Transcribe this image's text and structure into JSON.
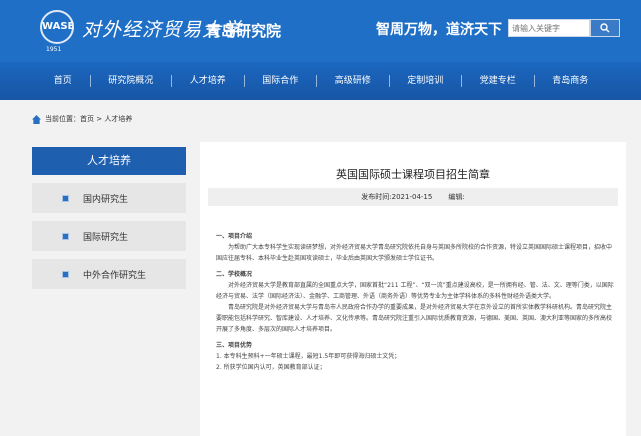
{
  "header": {
    "seal": "WASE",
    "year": "1951",
    "university": "对外经济贸易大学",
    "campus": "青岛研究院",
    "motto": "智周万物，道济天下",
    "search_placeholder": "请输入关键字",
    "search_button_icon": "search-icon"
  },
  "nav": [
    "首页",
    "研究院概况",
    "人才培养",
    "国际合作",
    "高级研修",
    "定制培训",
    "党建专栏",
    "青岛商务"
  ],
  "breadcrumb": "当前位置：首页 > 人才培养",
  "sidebar": {
    "title": "人才培养",
    "items": [
      "国内研究生",
      "国际研究生",
      "中外合作研究生"
    ]
  },
  "article": {
    "title": "英国国际硕士课程项目招生简章",
    "published": "发布时间:2021-04-15",
    "editor": "编辑:",
    "s1": "一、项目介绍",
    "p1": "为帮助广大本专科学生实现读研梦想，对外经济贸易大学青岛研究院依托自身与英国多所院校的合作资源，特设立英国国际硕士课程项目，招收中国应往届专科、本科毕业生赴英国攻读硕士，毕业后由英国大学颁发硕士学位证书。",
    "s2": "二、学校概况",
    "p2": "对外经济贸易大学是教育部直属的全国重点大学，国家首批“211 工程”、“双一流”重点建设高校，是一所拥有经、管、法、文、理等门类，以国际经济与贸易、法学（国际经济法）、金融学、工商管理、外语（商务外语）等优势专业为主体学科体系的多科性财经外语类大学。",
    "p3": "青岛研究院是对外经济贸易大学与青岛市人民政府合作办学的重要成果，是对外经济贸易大学在京外设立的首所实体教学科研机构。青岛研究院主要职能包括科学研究、智库建设、人才培养、文化传承等。青岛研究院注重引入国际优质教育资源，与德国、美国、英国、澳大利亚等国家的多所高校开展了多角度、多层次的国际人才培养项目。",
    "s3": "三、项目优势",
    "l1": "1. 本专科生预科+一年硕士课程，最短1.5年即可获得海归硕士文凭；",
    "l2": "2. 所获学位国内认可，英国教育部认证；"
  }
}
